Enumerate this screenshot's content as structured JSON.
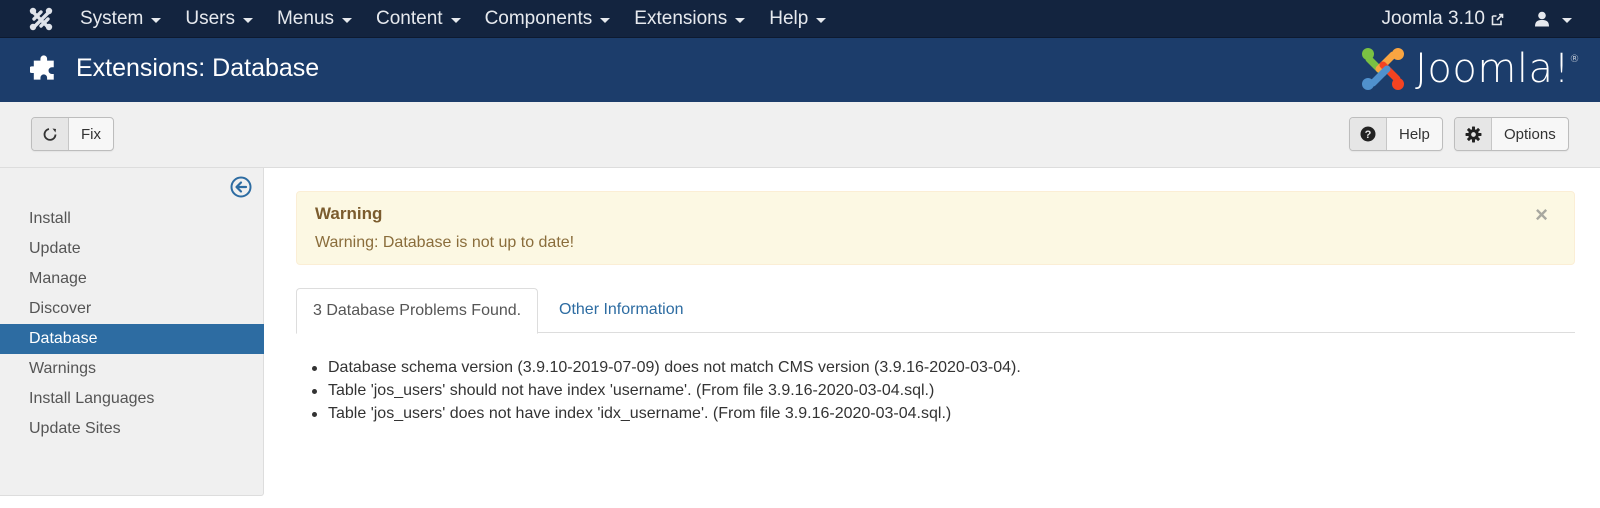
{
  "navbar": {
    "brand_icon": "joomla-icon",
    "menu": [
      {
        "label": "System"
      },
      {
        "label": "Users"
      },
      {
        "label": "Menus"
      },
      {
        "label": "Content"
      },
      {
        "label": "Components"
      },
      {
        "label": "Extensions"
      },
      {
        "label": "Help"
      }
    ],
    "site_link": "Joomla 3.10",
    "site_link_icon": "external-link-icon",
    "user_icon": "user-icon"
  },
  "header": {
    "title": "Extensions: Database",
    "title_icon": "puzzle-piece-icon",
    "logo_text": "Joomla!",
    "logo_mark": "®"
  },
  "toolbar": {
    "fix": {
      "label": "Fix",
      "icon": "refresh-icon"
    },
    "help": {
      "label": "Help",
      "icon": "question-circle-icon"
    },
    "options": {
      "label": "Options",
      "icon": "gear-icon"
    }
  },
  "sidebar": {
    "collapse_icon": "arrow-left-circle-icon",
    "items": [
      {
        "label": "Install"
      },
      {
        "label": "Update"
      },
      {
        "label": "Manage"
      },
      {
        "label": "Discover"
      },
      {
        "label": "Database",
        "active": true
      },
      {
        "label": "Warnings"
      },
      {
        "label": "Install Languages"
      },
      {
        "label": "Update Sites"
      }
    ]
  },
  "alert": {
    "heading": "Warning",
    "message": "Warning: Database is not up to date!",
    "close": "×"
  },
  "tabs": [
    {
      "label": "3 Database Problems Found.",
      "active": true
    },
    {
      "label": "Other Information",
      "active": false
    }
  ],
  "problems": [
    "Database schema version (3.9.10-2019-07-09) does not match CMS version (3.9.16-2020-03-04).",
    "Table 'jos_users' should not have index 'username'. (From file 3.9.16-2020-03-04.sql.)",
    "Table 'jos_users' does not have index 'idx_username'. (From file 3.9.16-2020-03-04.sql.)"
  ],
  "colors": {
    "navbar_bg": "#13243f",
    "header_bg": "#1c3d6b",
    "active_item": "#2d6ca2",
    "alert_bg": "#fcf8e3",
    "alert_text": "#8a6d3b",
    "link": "#2d6ca2"
  }
}
